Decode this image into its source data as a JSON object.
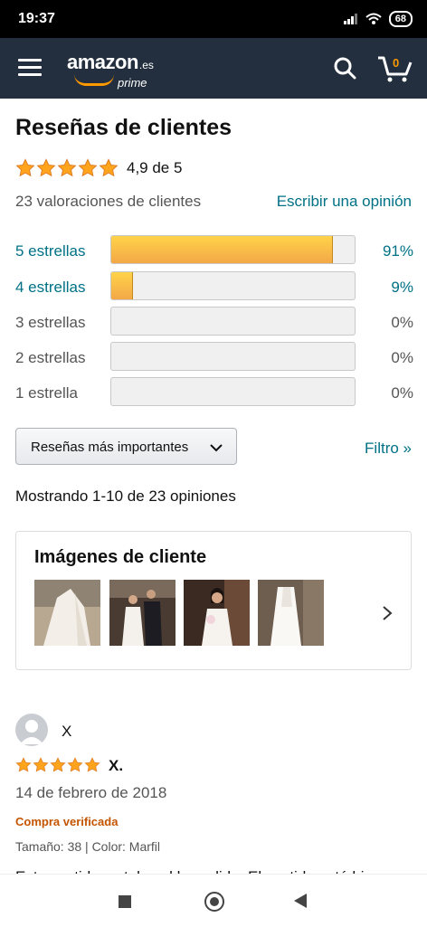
{
  "status_bar": {
    "time": "19:37",
    "battery": "68"
  },
  "header": {
    "logo_word": "amazon",
    "logo_suffix": ".es",
    "logo_prime": "prime",
    "cart_count": "0",
    "accent": "#ff9900"
  },
  "reviews": {
    "title": "Reseñas de clientes",
    "rating_text": "4,9 de 5",
    "ratings_count": "23 valoraciones de clientes",
    "write_review": "Escribir una opinión",
    "histogram": [
      {
        "label": "5 estrellas",
        "percent": "91%",
        "value": 0.91
      },
      {
        "label": "4 estrellas",
        "percent": "9%",
        "value": 0.09
      },
      {
        "label": "3 estrellas",
        "percent": "0%",
        "value": 0
      },
      {
        "label": "2 estrellas",
        "percent": "0%",
        "value": 0
      },
      {
        "label": "1 estrella",
        "percent": "0%",
        "value": 0
      }
    ],
    "sort_label": "Reseñas más importantes",
    "filter_label": "Filtro »",
    "showing": "Mostrando 1-10 de 23 opiniones"
  },
  "customer_images": {
    "title": "Imágenes de cliente"
  },
  "review": {
    "name": "X",
    "title": "X.",
    "date": "14 de febrero de 2018",
    "verified": "Compra verificada",
    "variant": "Tamaño: 38  |  Color: Marfil",
    "body": "Este vestido es tal cual lo pedido. El vestido está bien."
  }
}
